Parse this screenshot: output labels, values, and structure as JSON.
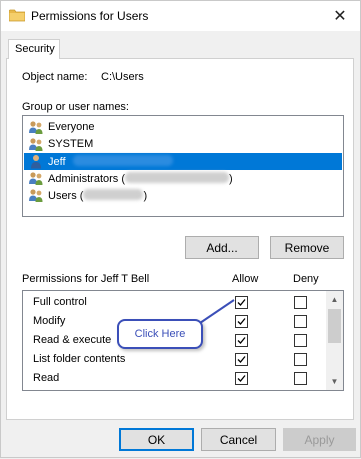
{
  "window": {
    "title": "Permissions for Users",
    "close_glyph": "✕"
  },
  "tabs": [
    {
      "label": "Security"
    }
  ],
  "object": {
    "label": "Object name:",
    "value": "C:\\Users"
  },
  "groups": {
    "label": "Group or user names:",
    "items": [
      {
        "name": "Everyone",
        "icon": "group-icon",
        "selected": false
      },
      {
        "name": "SYSTEM",
        "icon": "group-icon",
        "selected": false
      },
      {
        "name": "Jeff",
        "icon": "user-icon",
        "selected": true
      },
      {
        "name": "Administrators (",
        "icon": "group-icon",
        "selected": false,
        "suffix": ")"
      },
      {
        "name": "Users (",
        "icon": "group-icon",
        "selected": false,
        "suffix": ")"
      }
    ]
  },
  "buttons": {
    "add": "Add...",
    "remove": "Remove",
    "ok": "OK",
    "cancel": "Cancel",
    "apply": "Apply"
  },
  "permissions": {
    "header": "Permissions for Jeff T Bell",
    "allow_header": "Allow",
    "deny_header": "Deny",
    "rows": [
      {
        "name": "Full control",
        "allow": true,
        "deny": false
      },
      {
        "name": "Modify",
        "allow": true,
        "deny": false
      },
      {
        "name": "Read & execute",
        "allow": true,
        "deny": false
      },
      {
        "name": "List folder contents",
        "allow": true,
        "deny": false
      },
      {
        "name": "Read",
        "allow": true,
        "deny": false
      }
    ]
  },
  "callout": {
    "text": "Click Here"
  },
  "colors": {
    "selection": "#0078d7",
    "callout": "#3b4fb8"
  }
}
